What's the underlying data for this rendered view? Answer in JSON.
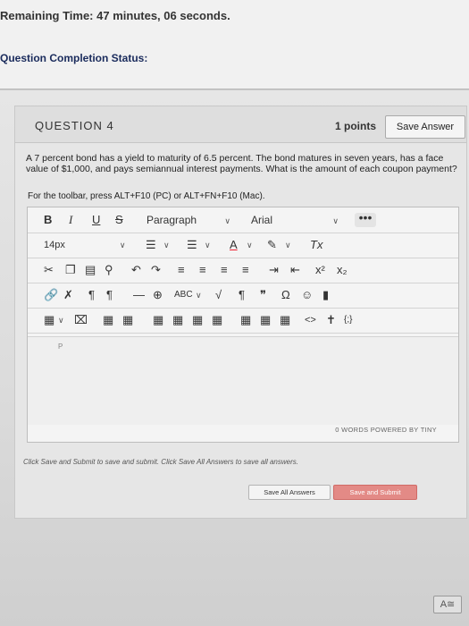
{
  "header": {
    "remaining_label": "Remaining Time:",
    "remaining_value": "47 minutes, 06 seconds.",
    "completion_label": "Question Completion Status:"
  },
  "question": {
    "number": "QUESTION 4",
    "points": "1 points",
    "save_label": "Save Answer",
    "text": "A 7 percent bond has a yield to maturity of 6.5 percent. The bond matures in seven years, has a face value of $1,000, and pays semiannual interest payments. What is the amount of each coupon payment?",
    "toolbar_hint": "For the toolbar, press ALT+F10 (PC) or ALT+FN+F10 (Mac)."
  },
  "editor": {
    "bold": "B",
    "italic": "I",
    "underline": "U",
    "strike": "S",
    "paragraph": "Paragraph",
    "font": "Arial",
    "more": "•••",
    "font_size": "14px",
    "font_color": "A",
    "clear_format": "Tx",
    "superscript": "x²",
    "subscript": "x₂",
    "code": "<>",
    "quote": "❞",
    "omega": "Ω",
    "paragraph_mark": "¶",
    "spellcheck": "ABC",
    "empty_para": "P",
    "word_count": "0 WORDS   POWERED BY TINY"
  },
  "footer": {
    "instructions": "Click Save and Submit to save and submit. Click Save All Answers to save all answers.",
    "save_all": "Save All Answers",
    "save_submit": "Save and Submit"
  }
}
